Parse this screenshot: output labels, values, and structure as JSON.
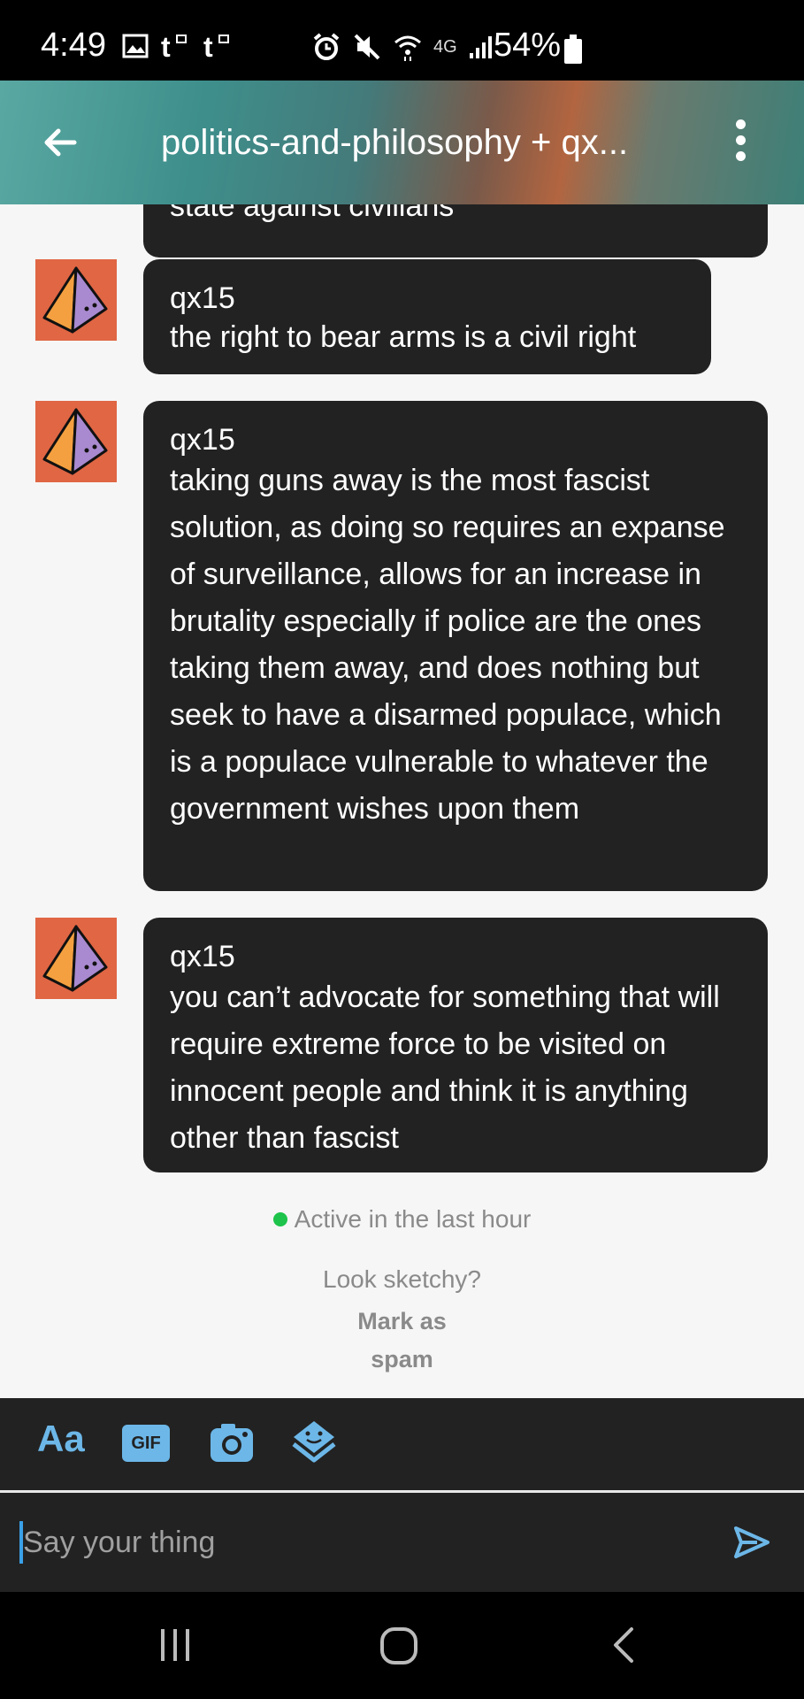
{
  "status_bar": {
    "time": "4:49",
    "battery": "54%",
    "network": "4G"
  },
  "header": {
    "title": "politics-and-philosophy + qx...",
    "back_icon": "arrow-left-icon",
    "menu_icon": "kebab-menu-icon"
  },
  "messages": [
    {
      "author": "",
      "text": "state against civilians"
    },
    {
      "author": "qx15",
      "text": "the right to bear arms is a civil right"
    },
    {
      "author": "qx15",
      "text": "taking guns away is the most fascist solution, as doing so requires an expanse of surveillance, allows for an increase in brutality especially if police are the ones taking them away, and does nothing but seek to have a disarmed populace, which is a populace vulnerable to whatever the government wishes upon them"
    },
    {
      "author": "qx15",
      "text": "you can’t advocate for something that will require extreme force to be visited on innocent people and think it is anything other than fascist"
    }
  ],
  "presence": {
    "text": "Active in the last hour",
    "color": "#1dc34a"
  },
  "spam": {
    "prompt": "Look sketchy?",
    "link_line1": "Mark as",
    "link_line2": "spam"
  },
  "toolbar": {
    "text_format_label": "Aa",
    "gif_label": "GIF",
    "accent": "#6cb7e8"
  },
  "composer": {
    "placeholder": "Say your thing"
  },
  "colors": {
    "bubble": "#222222",
    "avatar_bg": "#e06644",
    "background": "#f6f6f6"
  }
}
